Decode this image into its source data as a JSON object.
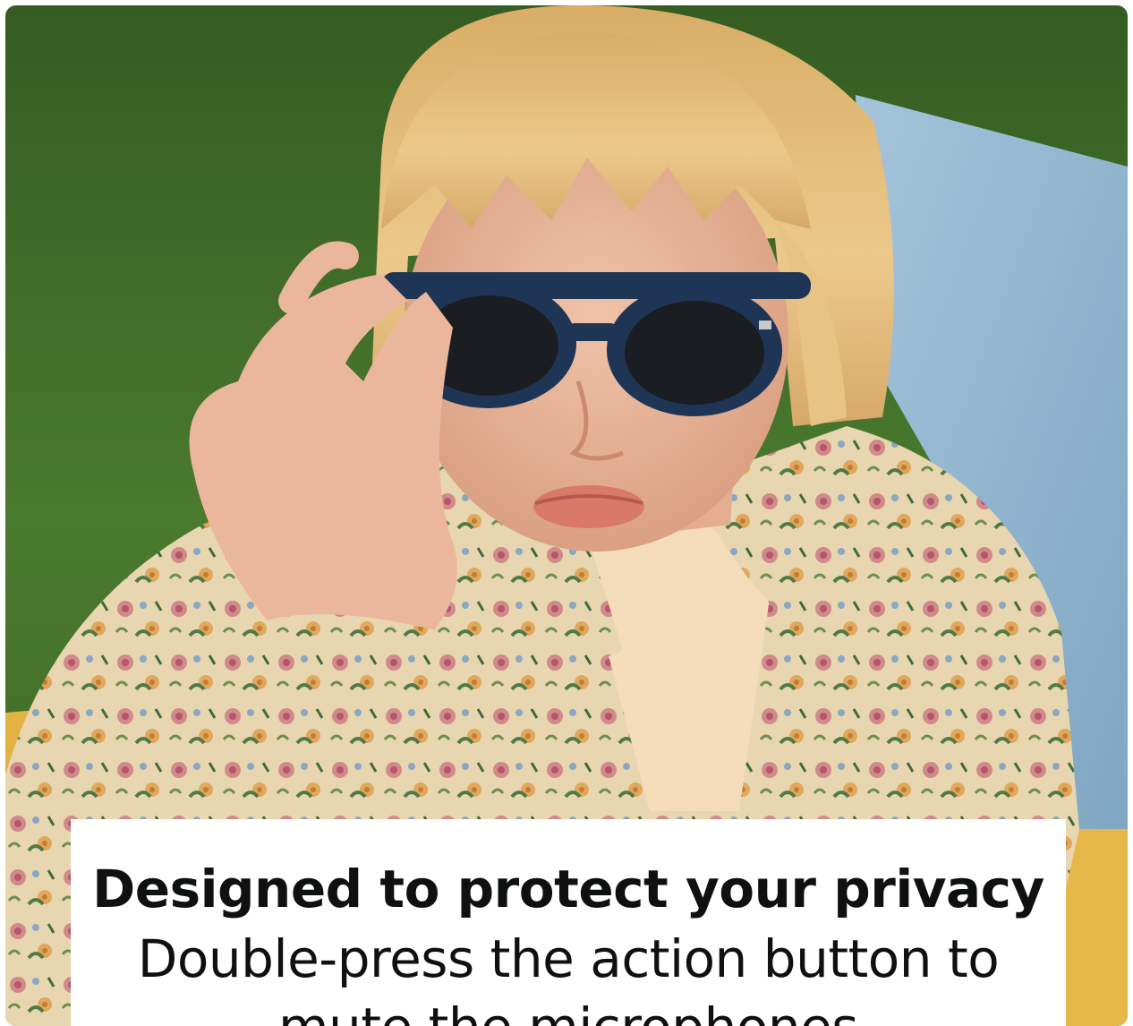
{
  "image": {
    "subject": "woman-with-sunglasses",
    "colors": {
      "grass": "#3f6b2a",
      "blanket_blue": "#8fb3cc",
      "blanket_yellow": "#e2b243",
      "hair": "#e3bd7c",
      "skin": "#e8b79c",
      "sunglasses_frame": "#1f3556",
      "lens": "#1a1e22",
      "jacket": "#e6d3ae"
    }
  },
  "caption": {
    "headline": "Designed to protect your privacy",
    "body": "Double-press the action button to mute the microphones"
  }
}
